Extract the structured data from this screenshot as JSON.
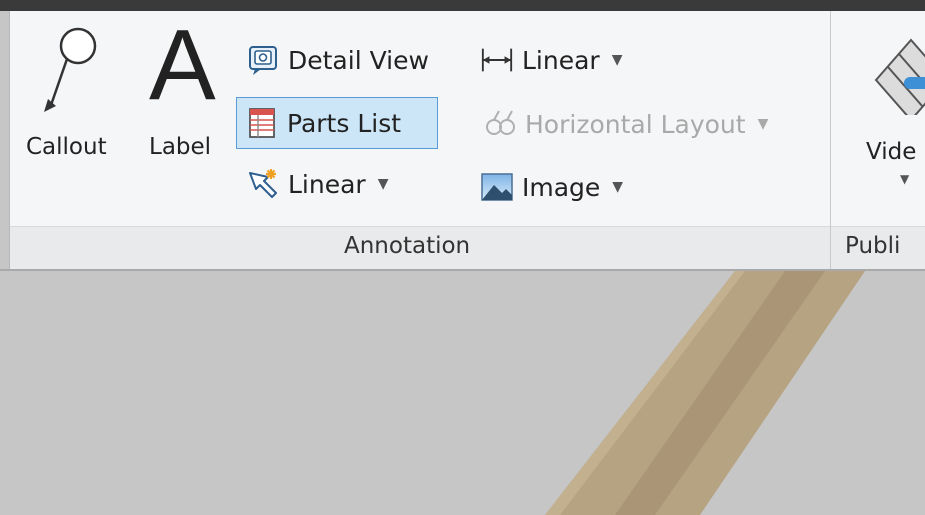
{
  "annotation_panel": {
    "title": "Annotation",
    "callout": "Callout",
    "label": "Label",
    "detail_view": "Detail View",
    "parts_list": "Parts List",
    "linear_leader": "Linear",
    "linear_dimension": "Linear",
    "horizontal_layout": "Horizontal Layout",
    "image": "Image"
  },
  "publish_panel": {
    "title": "Publi",
    "video": "Vide"
  },
  "colors": {
    "ribbon_bg": "#f5f6f7",
    "selected_bg": "#cde6f7",
    "selected_border": "#5b9bd5",
    "canvas_bg": "#c6c6c6",
    "beam": "#b6a382"
  }
}
